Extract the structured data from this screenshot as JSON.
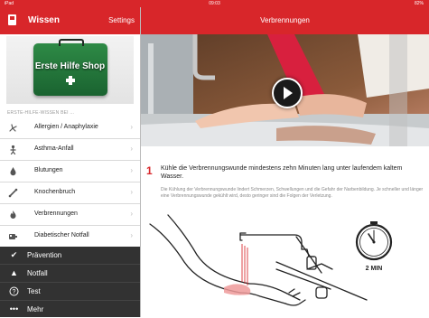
{
  "status_bar": {
    "carrier": "iPad",
    "time": "09:03",
    "battery": "82%"
  },
  "sidebar": {
    "title": "Wissen",
    "settings_label": "Settings",
    "shop_label": "Erste Hilfe Shop",
    "section_header": "ERSTE-HILFE-WISSEN BEI ...",
    "items": [
      {
        "label": "Allergien / Anaphylaxie",
        "icon": "allergy-icon"
      },
      {
        "label": "Asthma-Anfall",
        "icon": "asthma-icon"
      },
      {
        "label": "Blutungen",
        "icon": "bleeding-icon"
      },
      {
        "label": "Knochenbruch",
        "icon": "bone-fracture-icon"
      },
      {
        "label": "Verbrennungen",
        "icon": "burn-flame-icon"
      },
      {
        "label": "Diabetischer Notfall",
        "icon": "diabetes-icon"
      }
    ],
    "bottom_nav": [
      {
        "label": "Prävention",
        "icon": "checkmark-icon"
      },
      {
        "label": "Notfall",
        "icon": "warning-icon"
      },
      {
        "label": "Test",
        "icon": "question-icon"
      },
      {
        "label": "Mehr",
        "icon": "more-dots-icon"
      }
    ]
  },
  "main": {
    "title": "Verbrennungen",
    "step": {
      "number": "1",
      "text": "Kühle die Verbrennungswunde mindestens zehn Minuten lang unter laufendem kaltem Wasser.",
      "note": "Die Kühlung der Verbrennungswunde lindert Schmerzen, Schwellungen und die Gefahr der Narbenbildung. Je schneller und länger eine Verbrennungswunde gekühlt wird, desto geringer sind die Folgen der Verletzung."
    },
    "illustration": {
      "timer_label": "2 MIN"
    }
  },
  "colors": {
    "brand_red": "#d8262a",
    "dark_nav": "#323232"
  }
}
